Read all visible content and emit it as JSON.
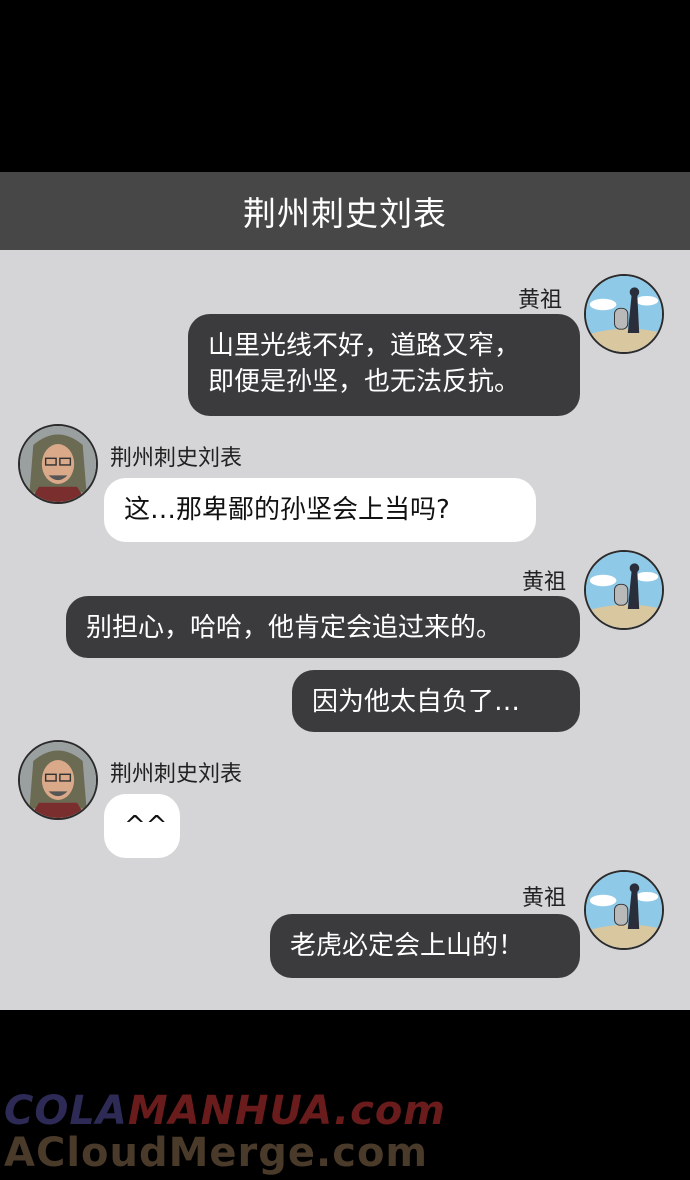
{
  "header": {
    "title": "荆州刺史刘表"
  },
  "messages": [
    {
      "sender": "黄祖",
      "text": "山里光线不好，道路又窄，\n即便是孙坚，也无法反抗。"
    },
    {
      "sender": "荆州刺史刘表",
      "text": "这…那卑鄙的孙坚会上当吗?"
    },
    {
      "sender": "黄祖",
      "text": "别担心，哈哈，他肯定会追过来的。"
    },
    {
      "sender": "黄祖",
      "text": "因为他太自负了…"
    },
    {
      "sender": "荆州刺史刘表",
      "text": "^^"
    },
    {
      "sender": "黄祖",
      "text": "老虎必定会上山的！"
    }
  ],
  "avatars": {
    "huangzu": "huang-zu-avatar",
    "liubiao": "liu-biao-avatar"
  },
  "watermark": {
    "line1_part1": "COLA",
    "line1_part2": "MANHUA.com",
    "line2": "ACloudMerge.com"
  },
  "colors": {
    "chat_bg": "#d5d4d7",
    "header_bg": "#474747",
    "dark_bubble": "#3b3b3d",
    "light_bubble": "#ffffff"
  }
}
